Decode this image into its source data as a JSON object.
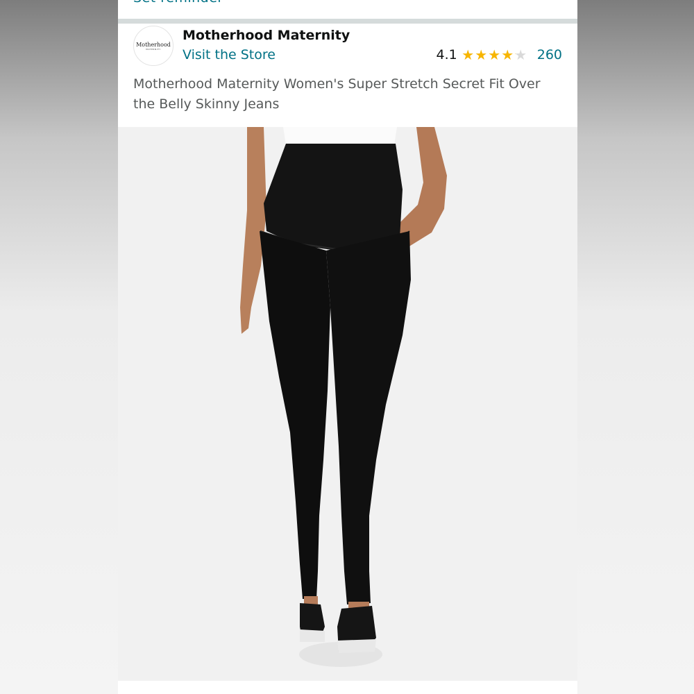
{
  "top": {
    "cut_text": "Set reminder"
  },
  "brand": {
    "logo_text": "Motherhood",
    "logo_subtext": "MATERNITY",
    "name": "Motherhood Maternity",
    "store_link": "Visit the Store"
  },
  "rating": {
    "value": "4.1",
    "stars": 4.1,
    "review_count": "260"
  },
  "product": {
    "title": "Motherhood Maternity Women's Super Stretch Secret Fit Over the Belly Skinny Jeans",
    "image_icon": "product-photo"
  },
  "colors": {
    "link": "#007185",
    "star": "#f7b500",
    "title_text": "#565959"
  }
}
